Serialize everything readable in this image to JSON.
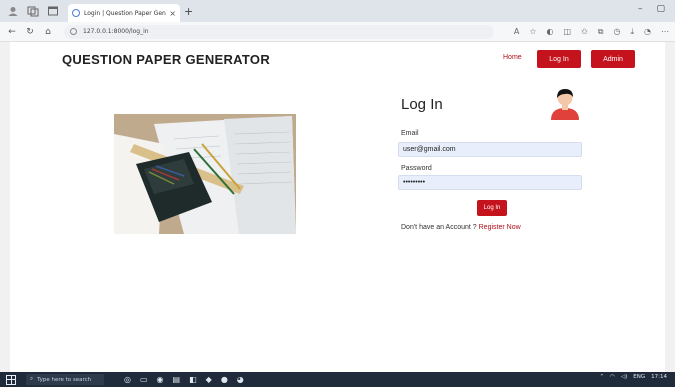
{
  "browser": {
    "tab_title": "Login | Question Paper Generat...",
    "tab_close": "×",
    "new_tab": "+",
    "url": "127.0.0.1:8000/log_in"
  },
  "navbar": {
    "brand": "QUESTION PAPER GENERATOR",
    "home": "Home",
    "login": "Log In",
    "admin": "Admin"
  },
  "form": {
    "title": "Log In",
    "email_label": "Email",
    "email_value": "user@gmail.com",
    "password_label": "Password",
    "password_value": "•••••••••",
    "submit": "Log In",
    "register_prompt": "Don't have an Account ?",
    "register_link": "Register Now"
  },
  "taskbar": {
    "search_placeholder": "Type here to search",
    "time": "17:14",
    "language": "ENG"
  },
  "colors": {
    "accent": "#c4131c"
  }
}
